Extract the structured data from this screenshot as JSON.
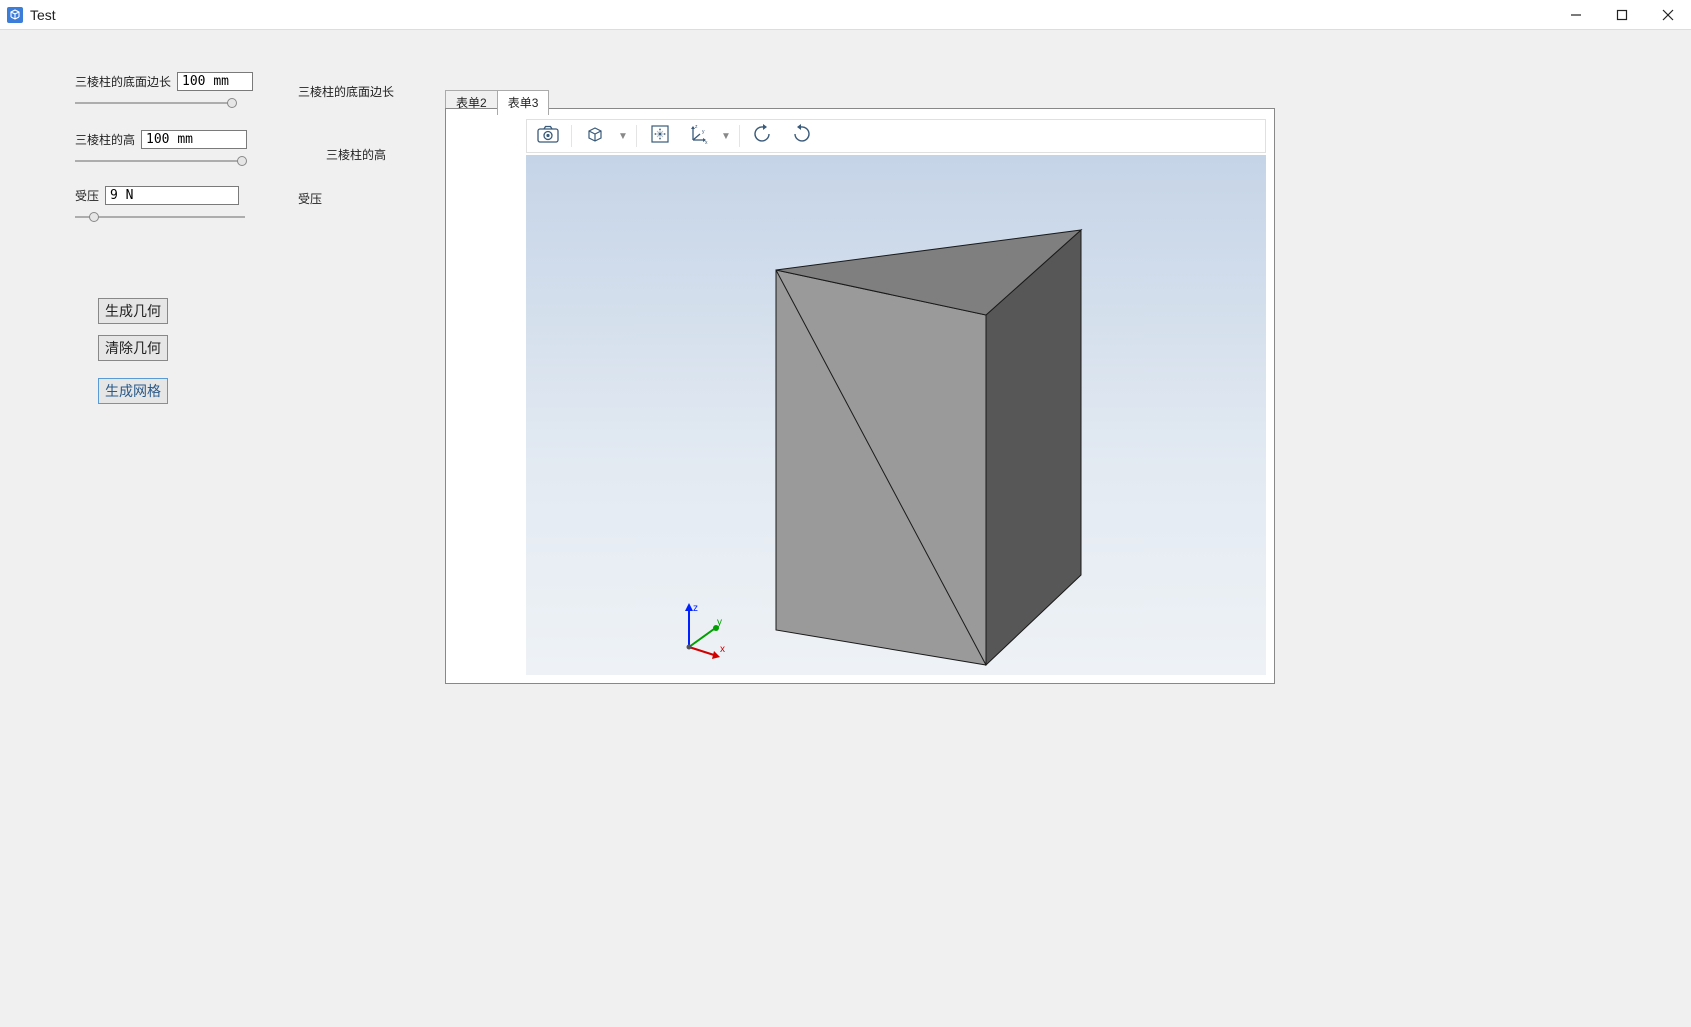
{
  "window": {
    "title": "Test"
  },
  "params": {
    "edge": {
      "label": "三棱柱的底面边长",
      "value": "100 mm"
    },
    "height": {
      "label": "三棱柱的高",
      "value": "100 mm"
    },
    "load": {
      "label": "受压",
      "value": "9 N"
    }
  },
  "right_labels": {
    "edge": "三棱柱的底面边长",
    "height": "三棱柱的高",
    "load": "受压"
  },
  "buttons": {
    "generate_geometry": "生成几何",
    "clear_geometry": "清除几何",
    "generate_mesh": "生成网格"
  },
  "tabs": {
    "t2": "表单2",
    "t3": "表单3",
    "active": "t3"
  },
  "axes": {
    "x": "x",
    "y": "y",
    "z": "z"
  }
}
